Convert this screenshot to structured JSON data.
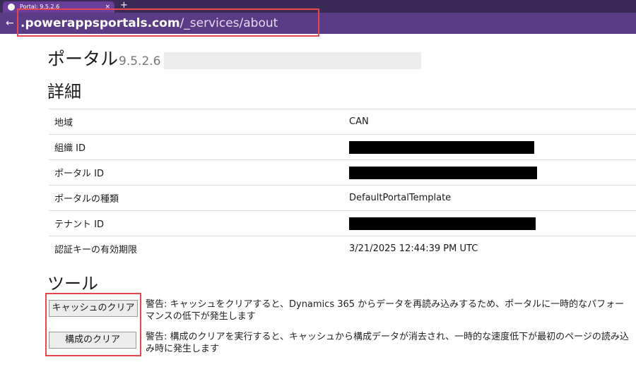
{
  "browser": {
    "tab_title": "Portal: 9.5.2.6",
    "tab_close": "×",
    "new_tab": "+",
    "back": "←",
    "url_host": ".powerappsportals.com",
    "url_path": "/_services/about"
  },
  "page": {
    "title": "ポータル",
    "version": "9.5.2.6",
    "details_heading": "詳細",
    "details": [
      {
        "label": "地域",
        "value": "CAN"
      },
      {
        "label": "組織 ID",
        "value": ""
      },
      {
        "label": "ポータル ID",
        "value": ""
      },
      {
        "label": "ポータルの種類",
        "value": "DefaultPortalTemplate"
      },
      {
        "label": "テナント ID",
        "value": ""
      },
      {
        "label": "認証キーの有効期限",
        "value": "3/21/2025 12:44:39 PM UTC"
      }
    ],
    "tools_heading": "ツール",
    "clear_cache_button": "キャッシュのクリア",
    "clear_cache_warning": "警告: キャッシュをクリアすると、Dynamics 365 からデータを再読み込みするため、ポータルに一時的なパフォーマンスの低下が発生します",
    "clear_config_button": "構成のクリア",
    "clear_config_warning": "警告: 構成のクリアを実行すると、キャッシュから構成データが消去され、一時的な速度低下が最初のページの読み込み時に発生します"
  },
  "colors": {
    "tab_bar": "#3b2a55",
    "address_bar": "#5b3a86",
    "highlight": "#e8474e"
  }
}
